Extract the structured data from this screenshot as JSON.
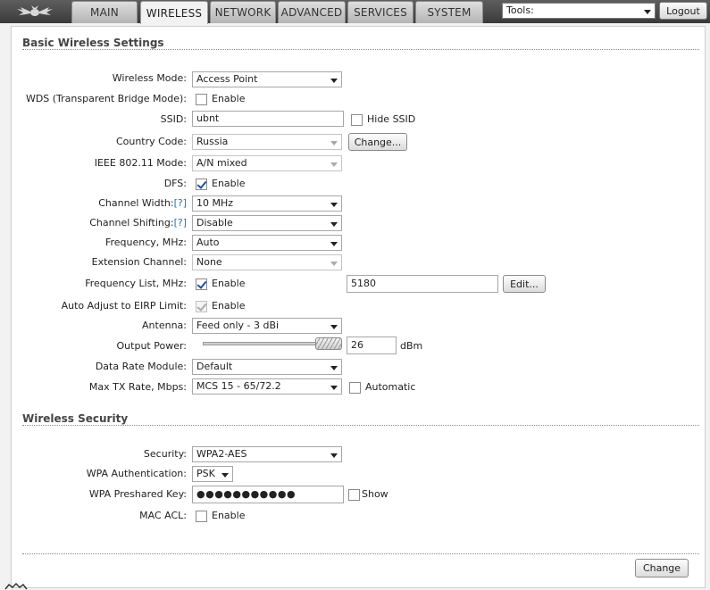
{
  "nav": {
    "tabs": [
      "MAIN",
      "WIRELESS",
      "NETWORK",
      "ADVANCED",
      "SERVICES",
      "SYSTEM"
    ],
    "active_tab": "WIRELESS",
    "tools_value": "Tools:",
    "logout_label": "Logout"
  },
  "basic": {
    "title": "Basic Wireless Settings",
    "wireless_mode": {
      "label": "Wireless Mode:",
      "value": "Access Point"
    },
    "wds": {
      "label": "WDS (Transparent Bridge Mode):",
      "checked": false,
      "text": "Enable"
    },
    "ssid": {
      "label": "SSID:",
      "value": "ubnt",
      "hide_text": "Hide SSID",
      "hide_checked": false
    },
    "country": {
      "label": "Country Code:",
      "value": "Russia",
      "button": "Change..."
    },
    "ieee": {
      "label": "IEEE 802.11 Mode:",
      "value": "A/N mixed"
    },
    "dfs": {
      "label": "DFS:",
      "checked": true,
      "text": "Enable"
    },
    "channel_width": {
      "label": "Channel Width:",
      "help": "[?]",
      "value": "10 MHz"
    },
    "channel_shifting": {
      "label": "Channel Shifting:",
      "help": "[?]",
      "value": "Disable"
    },
    "frequency": {
      "label": "Frequency, MHz:",
      "value": "Auto"
    },
    "extension": {
      "label": "Extension Channel:",
      "value": "None"
    },
    "freq_list": {
      "label": "Frequency List, MHz:",
      "checked": true,
      "text": "Enable",
      "value": "5180",
      "button": "Edit..."
    },
    "eirp": {
      "label": "Auto Adjust to EIRP Limit:",
      "checked": true,
      "text": "Enable"
    },
    "antenna": {
      "label": "Antenna:",
      "value": "Feed only - 3 dBi"
    },
    "output_power": {
      "label": "Output Power:",
      "value": "26",
      "unit": "dBm",
      "slider_fraction": 1.0
    },
    "data_rate": {
      "label": "Data Rate Module:",
      "value": "Default"
    },
    "max_tx": {
      "label": "Max TX Rate, Mbps:",
      "value": "MCS 15 - 65/72.2",
      "auto_text": "Automatic",
      "auto_checked": false
    }
  },
  "security": {
    "title": "Wireless Security",
    "security": {
      "label": "Security:",
      "value": "WPA2-AES"
    },
    "wpa_auth": {
      "label": "WPA Authentication:",
      "value": "PSK"
    },
    "wpa_key": {
      "label": "WPA Preshared Key:",
      "value": "●●●●●●●●●●●",
      "show_text": "Show",
      "show_checked": false
    },
    "mac_acl": {
      "label": "MAC ACL:",
      "checked": false,
      "text": "Enable"
    }
  },
  "footer": {
    "change_label": "Change"
  },
  "colors": {
    "accent": "#2a6fb0",
    "tab_bar": "#3a3a3a",
    "panel_bg": "#ffffff"
  }
}
